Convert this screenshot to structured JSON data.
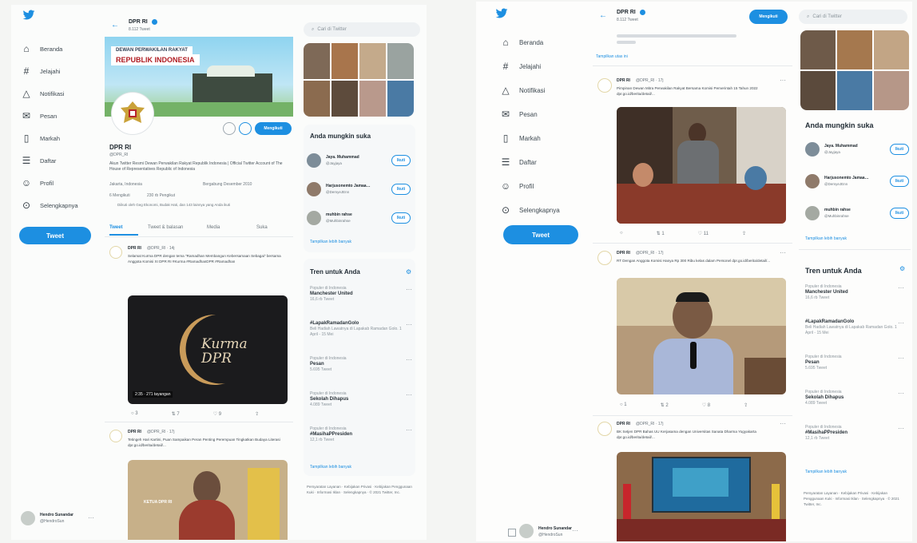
{
  "left": {
    "nav": [
      {
        "icon": "house-icon",
        "glyph": "⌂",
        "label": "Beranda"
      },
      {
        "icon": "hashtag-icon",
        "glyph": "#",
        "label": "Jelajahi"
      },
      {
        "icon": "bell-icon",
        "glyph": "△",
        "label": "Notifikasi"
      },
      {
        "icon": "mail-icon",
        "glyph": "✉",
        "label": "Pesan"
      },
      {
        "icon": "bookmark-icon",
        "glyph": "▯",
        "label": "Markah"
      },
      {
        "icon": "list-icon",
        "glyph": "☰",
        "label": "Daftar"
      },
      {
        "icon": "person-icon",
        "glyph": "☺",
        "label": "Profil"
      },
      {
        "icon": "more-circle-icon",
        "glyph": "⊙",
        "label": "Selengkapnya"
      }
    ],
    "tweet_button": "Tweet",
    "profile_header": {
      "name": "DPR RI",
      "subtitle": "8.112 Tweet"
    },
    "banner": {
      "line1": "DEWAN PERWAKILAN RAKYAT",
      "line2": "REPUBLIK INDONESIA"
    },
    "profile": {
      "name": "DPR RI",
      "handle": "@DPR_RI",
      "bio": "Akun Twitter Resmi Dewan Perwakilan Rakyat Republik Indonesia | Official Twitter Account of The House of Representatives Republic of Indonesia",
      "location": "Jakarta, Indonesia",
      "joined": "Bergabung Desember 2010",
      "following": "6 Mengikuti",
      "followers": "230 rb Pengikut",
      "followed_by": "Diikuti oleh Geg Ekonomi, Budak Hati, dan 143 lainnya yang Anda ikuti",
      "follow_label": "Mengikuti"
    },
    "tabs": [
      "Tweet",
      "Tweet & balasan",
      "Media",
      "Suka"
    ],
    "tweet1": {
      "name": "DPR RI",
      "handle": "@DPR_RI · 14j",
      "text": "Selamat Kurma DPR dengan tema \"Ramadhan Membangun Kebersamaan Sebagai\" bersama Anggota Komisi XI DPR RI #Kurma #RamadhanDPR #Ramadhan",
      "media_text": "Kurma DPR",
      "video_meta": "2:35 · 271 tayangan",
      "replies": "3",
      "retweets": "7",
      "likes": "9"
    },
    "tweet2": {
      "name": "DPR RI",
      "handle": "@DPR_RI · 17j",
      "text": "Tetingeh Hari Kartini, Puan Sampaikan Peran Penting Perempuan Tingkatkan Budaya Literasi dpr.go.id/berita/detail/...",
      "media_text": "KETUA DPR RI"
    },
    "user": {
      "name": "Hendro Sunandar",
      "handle": "@HendroSun"
    }
  },
  "left_side": {
    "search_placeholder": "Cari di Twitter",
    "who_to_follow": "Anda mungkin suka",
    "suggestions": [
      {
        "name": "Jaya. Muhammad",
        "handle": "@Jayjaya"
      },
      {
        "name": "Harjusonemto Jamaa…",
        "handle": "@DemyeJEnn"
      },
      {
        "name": "muhbin rahse",
        "handle": "@Muhbinrahse"
      }
    ],
    "follow_label": "Ikuti",
    "show_more": "Tampilkan lebih banyak",
    "trends_title": "Tren untuk Anda",
    "trends": [
      {
        "cat": "Populer di Indonesia",
        "name": "Manchester United",
        "count": "16,6 rb Tweet"
      },
      {
        "cat": "",
        "name": "#LapakRamadanGolo",
        "count": "Beli Hadiah Lawatnya di Lapakab Ramadan Golo. 1 April - 15 Mei"
      },
      {
        "cat": "Populer di Indonesia",
        "name": "Pesan",
        "count": "5.695 Tweet"
      },
      {
        "cat": "Populer di Indonesia",
        "name": "Sekolah Dihapus",
        "count": "4.089 Tweet"
      },
      {
        "cat": "Populer di Indonesia",
        "name": "#MasihaPPresiden",
        "count": "12,1 rb Tweet"
      }
    ],
    "show_more2": "Tampilkan lebih banyak",
    "footer": "Persyaratan Layanan · Kebijakan Privasi · Kebijakan Penggunaan Kuki · Informasi Iklan · Selengkapnya · © 2021 Twitter, Inc."
  },
  "right": {
    "nav": [
      {
        "icon": "house-icon",
        "glyph": "⌂",
        "label": "Beranda"
      },
      {
        "icon": "hashtag-icon",
        "glyph": "#",
        "label": "Jelajahi"
      },
      {
        "icon": "bell-icon",
        "glyph": "△",
        "label": "Notifikasi"
      },
      {
        "icon": "mail-icon",
        "glyph": "✉",
        "label": "Pesan"
      },
      {
        "icon": "bookmark-icon",
        "glyph": "▯",
        "label": "Markah"
      },
      {
        "icon": "list-icon",
        "glyph": "☰",
        "label": "Daftar"
      },
      {
        "icon": "person-icon",
        "glyph": "☺",
        "label": "Profil"
      },
      {
        "icon": "more-circle-icon",
        "glyph": "⊙",
        "label": "Selengkapnya"
      }
    ],
    "tweet_button": "Tweet",
    "profile_header": {
      "name": "DPR RI",
      "subtitle": "8.112 Tweet",
      "follow_label": "Mengikuti"
    },
    "show_thread": "Tampilkan utas ini",
    "tweet1": {
      "name": "DPR RI",
      "handle": "@DPR_RI · 17j",
      "text": "Pimpinan Dewan Mitra Perwakilan Rakyat Bersama Komisi Pemerintah 15 Tahun 2022 dpr.go.id/berita/detail/...",
      "replies": "",
      "retweets": "1",
      "likes": "11"
    },
    "tweet2": {
      "name": "DPR RI",
      "handle": "@DPR_RI · 17j",
      "text": "RT Dengan Anggota Komisi Hanya Rp 300 Ribu kelas dalam Personel dpr.go.id/berita/detail/...",
      "replies": "1",
      "retweets": "2",
      "likes": "8"
    },
    "tweet3": {
      "name": "DPR RI",
      "handle": "@DPR_RI · 17j",
      "text": "BK Setjen DPR Bahas UU Kerjasama dengan Universitas Sanata Dharma Yogyakarta dpr.go.id/berita/detail/..."
    },
    "user": {
      "name": "Hendro Sunandar",
      "handle": "@HendroSun"
    }
  },
  "right_side": {
    "search_placeholder": "Cari di Twitter",
    "who_to_follow": "Anda mungkin suka",
    "suggestions": [
      {
        "name": "Jaya. Muhammad",
        "handle": "@Jayjaya"
      },
      {
        "name": "Harjusonemto Jamaa…",
        "handle": "@DemyeJEnn"
      },
      {
        "name": "muhbin rahse",
        "handle": "@Muhbinrahse"
      }
    ],
    "follow_label": "Ikuti",
    "show_more": "Tampilkan lebih banyak",
    "trends_title": "Tren untuk Anda",
    "trends": [
      {
        "cat": "Populer di Indonesia",
        "name": "Manchester United",
        "count": "16,6 rb Tweet"
      },
      {
        "cat": "",
        "name": "#LapakRamadanGolo",
        "count": "Beli Hadiah Lawatnya di Lapakab Ramadan Golo. 1 April - 15 Mei"
      },
      {
        "cat": "Populer di Indonesia",
        "name": "Pesan",
        "count": "5.695 Tweet"
      },
      {
        "cat": "Populer di Indonesia",
        "name": "Sekolah Dihapus",
        "count": "4.089 Tweet"
      },
      {
        "cat": "Populer di Indonesia",
        "name": "#MasihaPPresiden",
        "count": "12,1 rb Tweet"
      }
    ],
    "show_more2": "Tampilkan lebih banyak",
    "footer": "Persyaratan Layanan · Kebijakan Privasi · Kebijakan Penggunaan Kuki · Informasi Iklan · Selengkapnya · © 2021 Twitter, Inc."
  },
  "colors": {
    "accent": "#1d8fe1",
    "text": "#1f2a33",
    "muted": "#6a747c"
  }
}
